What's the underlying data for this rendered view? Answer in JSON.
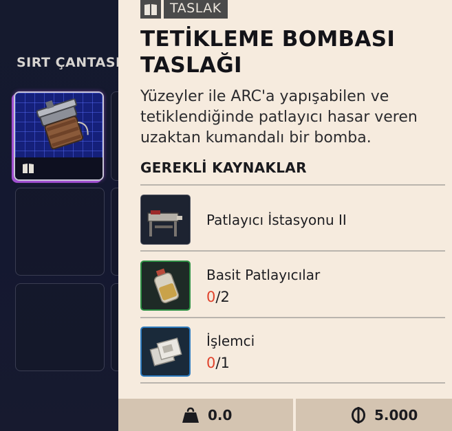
{
  "backpack": {
    "title": "SIRT ÇANTASI"
  },
  "detail": {
    "tag_label": "TASLAK",
    "title": "TETİKLEME BOMBASI TASLAĞI",
    "description": "Yüzeyler ile ARC'a yapışabilen ve tetiklendiğinde patlayıcı hasar veren uzaktan kumandalı bir bomba.",
    "required_title": "GEREKLİ KAYNAKLAR",
    "resources": [
      {
        "name": "Patlayıcı İstasyonu II",
        "have": "",
        "need": "",
        "icon": "workbench-icon"
      },
      {
        "name": "Basit Patlayıcılar",
        "have": "0",
        "need": "/2",
        "icon": "explosive-bottle-icon"
      },
      {
        "name": "İşlemci",
        "have": "0",
        "need": "/1",
        "icon": "processor-chip-icon"
      }
    ],
    "footer": {
      "weight": "0.0",
      "price": "5.000",
      "weight_icon": "weight-icon",
      "price_icon": "coin-icon"
    }
  },
  "colors": {
    "panel_bg": "#f6ebde",
    "accent_red": "#e0432c",
    "rarity_purple": "#a04fd0"
  }
}
